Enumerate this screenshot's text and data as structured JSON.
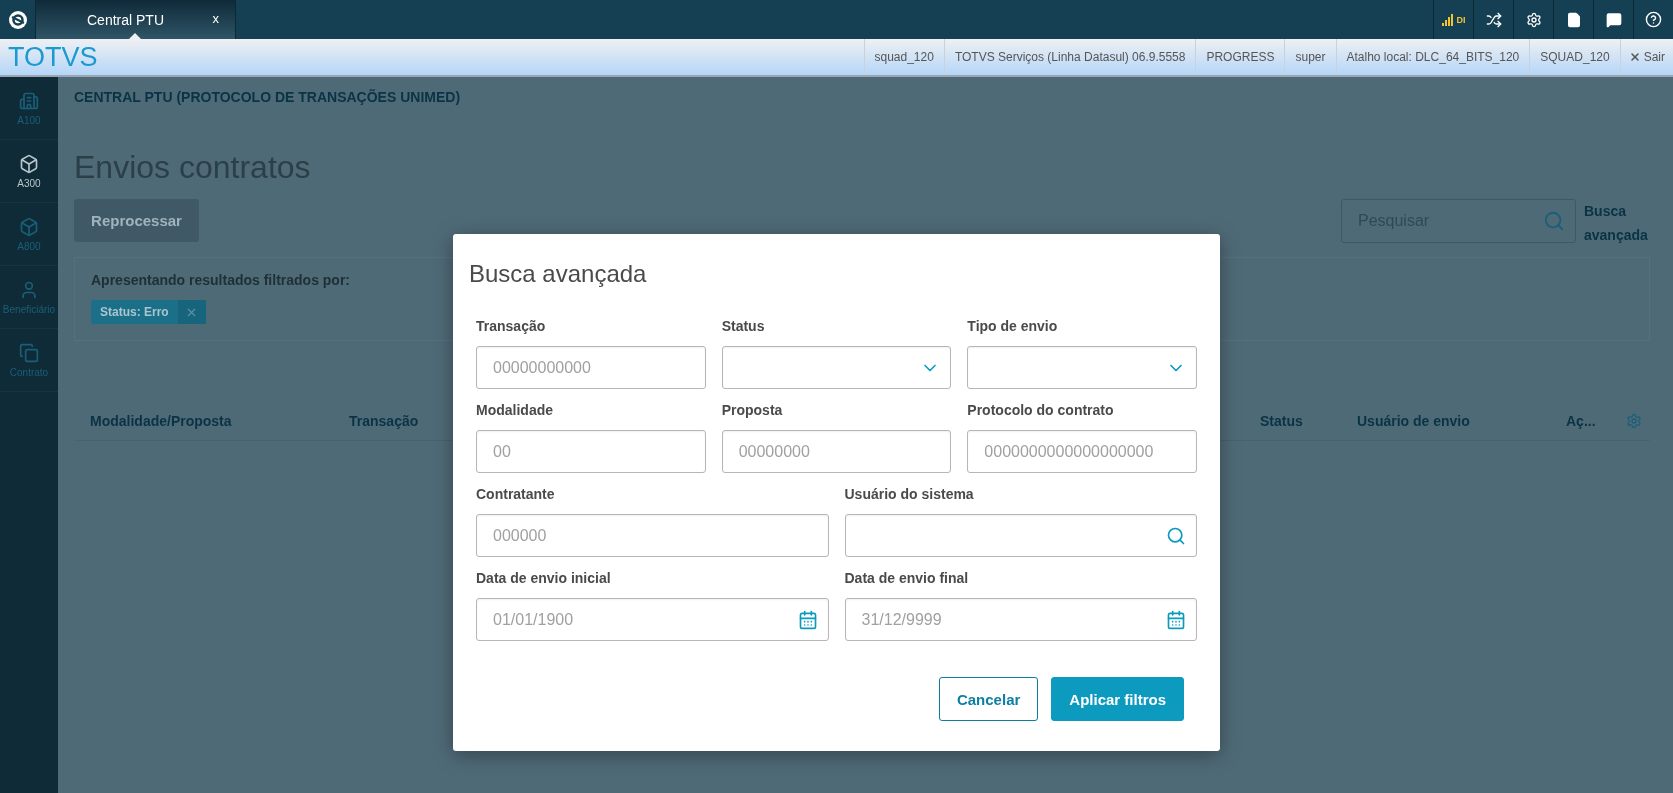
{
  "app_bar": {
    "tabs": [
      {
        "label": "Central PTU",
        "close": "x",
        "selected": true
      }
    ],
    "signal_label": "DI"
  },
  "info_bar": {
    "brand": "TOTVS",
    "items": [
      "squad_120",
      "TOTVS Serviços (Linha Datasul) 06.9.5558",
      "PROGRESS",
      "super",
      "Atalho local: DLC_64_BITS_120",
      "SQUAD_120"
    ],
    "logout": "Sair"
  },
  "sidebar": {
    "items": [
      {
        "label": "A100",
        "kind": "building",
        "selected": false
      },
      {
        "label": "A300",
        "kind": "box",
        "selected": true
      },
      {
        "label": "A800",
        "kind": "box",
        "selected": false
      },
      {
        "label": "Beneficiário",
        "kind": "person",
        "selected": false
      },
      {
        "label": "Contrato",
        "kind": "copy",
        "selected": false
      }
    ]
  },
  "page": {
    "breadcrumb": "CENTRAL PTU (PROTOCOLO DE TRANSAÇÕES UNIMED)",
    "title": "Envios contratos",
    "reprocess_button": {
      "label": "Reprocessar",
      "disabled": true
    },
    "search": {
      "placeholder": "Pesquisar"
    },
    "advanced_search_link": "Busca avançada",
    "filter_panel": {
      "caption": "Apresentando resultados filtrados por:",
      "chips": [
        {
          "label": "Status: Erro"
        }
      ]
    },
    "table": {
      "columns": [
        "Modalidade/Proposta",
        "Transação",
        "Status",
        "Usuário de envio",
        "Aç..."
      ]
    }
  },
  "modal": {
    "title": "Busca avançada",
    "rows": [
      {
        "fields": [
          {
            "label": "Transação",
            "kind": "text",
            "placeholder": "00000000000"
          },
          {
            "label": "Status",
            "kind": "select"
          },
          {
            "label": "Tipo de envio",
            "kind": "select"
          }
        ]
      },
      {
        "fields": [
          {
            "label": "Modalidade",
            "kind": "text",
            "placeholder": "00"
          },
          {
            "label": "Proposta",
            "kind": "text",
            "placeholder": "00000000"
          },
          {
            "label": "Protocolo do contrato",
            "kind": "text",
            "placeholder": "0000000000000000000"
          }
        ]
      },
      {
        "fields": [
          {
            "label": "Contratante",
            "kind": "text",
            "placeholder": "000000"
          },
          {
            "label": "Usuário do sistema",
            "kind": "lookup"
          }
        ]
      },
      {
        "fields": [
          {
            "label": "Data de envio inicial",
            "kind": "date",
            "placeholder": "01/01/1900"
          },
          {
            "label": "Data de envio final",
            "kind": "date",
            "placeholder": "31/12/9999"
          }
        ]
      }
    ],
    "buttons": [
      {
        "label": "Cancelar",
        "kind": "secondary"
      },
      {
        "label": "Aplicar filtros",
        "kind": "primary"
      }
    ]
  }
}
